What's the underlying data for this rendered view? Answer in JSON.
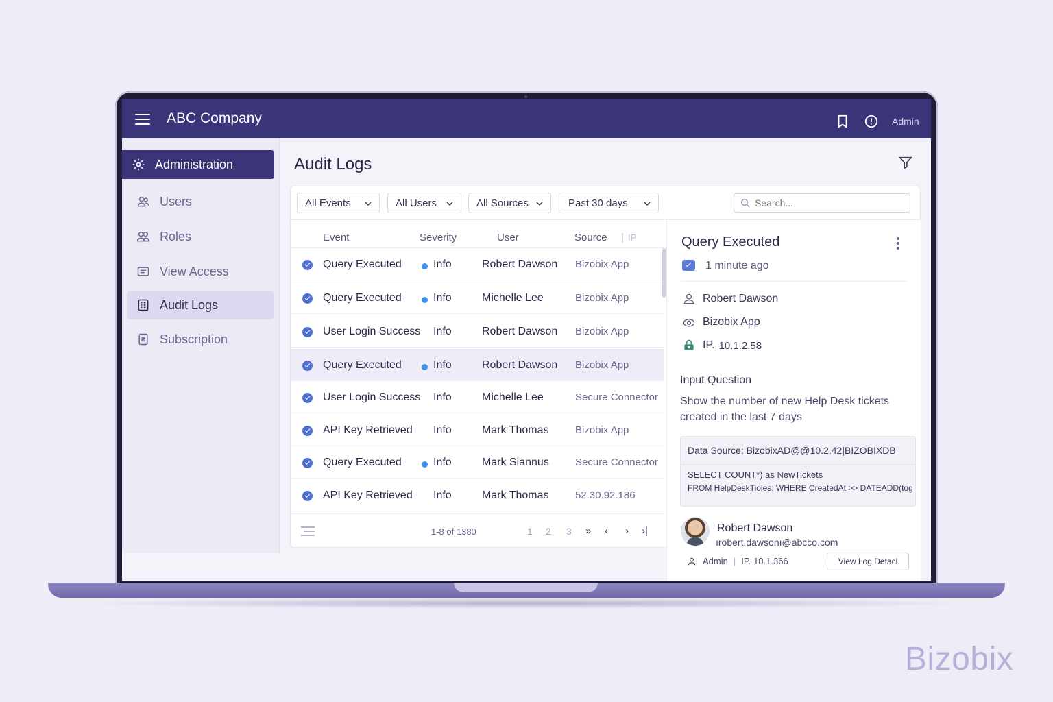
{
  "app": {
    "title": "ABC Company",
    "user_label": "Admin",
    "watermark": "Bizobix"
  },
  "sidebar": {
    "items": [
      {
        "label": "Administration",
        "icon": "gear-icon"
      },
      {
        "label": "Users",
        "icon": "users-icon"
      },
      {
        "label": "Roles",
        "icon": "roles-icon"
      },
      {
        "label": "View Access",
        "icon": "view-access-icon"
      },
      {
        "label": "Audit Logs",
        "icon": "audit-logs-icon"
      },
      {
        "label": "Subscription",
        "icon": "subscription-icon"
      }
    ],
    "active": "Audit Logs"
  },
  "main": {
    "title": "Audit Logs",
    "filters": {
      "events": "All Events",
      "users": "All Users",
      "sources": "All Sources",
      "range": "Past 30 days"
    },
    "search": {
      "placeholder": "Search...",
      "value": ""
    }
  },
  "table": {
    "headers": {
      "event": "Event",
      "severity": "Severity",
      "user": "User",
      "source": "Source",
      "ip": "IP"
    },
    "rows": [
      {
        "event": "Query Executed",
        "severity": "Info",
        "dot": true,
        "user": "Robert Dawson",
        "source": "Bizobix App"
      },
      {
        "event": "Query Executed",
        "severity": "Info",
        "dot": true,
        "user": "Michelle Lee",
        "source": "Bizobix App"
      },
      {
        "event": "User Login Success",
        "severity": "Info",
        "dot": false,
        "user": "Robert Dawson",
        "source": "Bizobix App"
      },
      {
        "event": "Query Executed",
        "severity": "Info",
        "dot": true,
        "user": "Robert Dawson",
        "source": "Bizobix App"
      },
      {
        "event": "User Login Success",
        "severity": "Info",
        "dot": false,
        "user": "Michelle Lee",
        "source": "Secure Connector"
      },
      {
        "event": "API Key Retrieved",
        "severity": "Info",
        "dot": false,
        "user": "Mark Thomas",
        "source": "Bizobix App"
      },
      {
        "event": "Query Executed",
        "severity": "Info",
        "dot": true,
        "user": "Mark Siannus",
        "source": "Secure Connector"
      },
      {
        "event": "API Key Retrieved",
        "severity": "Info",
        "dot": false,
        "user": "Mark Thomas",
        "source": "52.30.92.186"
      }
    ],
    "selected_row": 3,
    "pagination": {
      "summary": "1-8 of 1380",
      "pages": [
        "1",
        "2",
        "3"
      ],
      "next_fast": "»",
      "prev": "‹",
      "next": "›",
      "last": "›|"
    }
  },
  "detail": {
    "title": "Query Executed",
    "time": "1 minute ago",
    "user": "Robert Dawson",
    "source": "Bizobix App",
    "ip_label": "IP.",
    "ip": "10.1.2.58",
    "question_label": "Input Question",
    "question": "Show the number of new Help Desk tickets created in the last 7 days",
    "data_source_label": "Data Source:",
    "data_source": "BizobixAD@@10.2.42|BIZOBIXDB",
    "query_line1": "SELECT COUNT*) as NewTickets",
    "query_line2": "FROM HelpDeskTioles: WHERE CreatedAt >> DATEADD(tog",
    "footer_user": {
      "name": "Robert Dawson",
      "email": "ırobert.dawsonı@abcco.com",
      "role": "Admin",
      "ip": "IP. 10.1.366"
    },
    "view_button": "View Log Detacl"
  },
  "colors": {
    "brand": "#3a3478",
    "check": "#4e6ed2",
    "info_dot": "#3f8de6",
    "background": "#eeecf6"
  }
}
